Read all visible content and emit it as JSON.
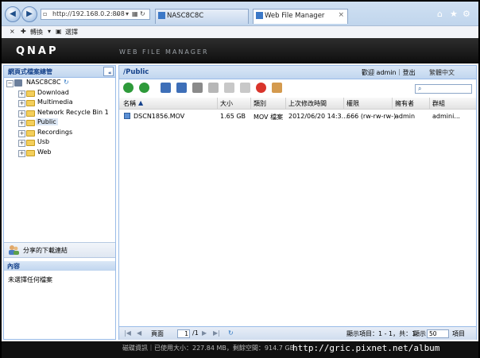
{
  "browser": {
    "address_url": "http://192.168.0.2:808",
    "tabs": [
      {
        "label": "NASC8C8C"
      },
      {
        "label": "Web File Manager"
      }
    ],
    "menubar": {
      "close": "×",
      "convert": "轉換",
      "select": "選擇"
    }
  },
  "app": {
    "logo": "QNAP",
    "title": "WEB FILE MANAGER"
  },
  "sidebar": {
    "header": "網頁式檔案總管",
    "root": "NASC8C8C",
    "folders": [
      "Download",
      "Multimedia",
      "Network Recycle Bin 1",
      "Public",
      "Recordings",
      "Usb",
      "Web"
    ],
    "selected_folder": "Public",
    "share_link": "分享的下載連結",
    "content_header": "內容",
    "content_text": "未選擇任何檔案"
  },
  "main": {
    "path": "/Public",
    "welcome": "歡迎 admin｜登出",
    "language": "繁體中文",
    "columns": [
      "名稱",
      "大小",
      "類別",
      "上次修改時間",
      "權限",
      "擁有者",
      "群組"
    ],
    "rows": [
      {
        "name": "DSCN1856.MOV",
        "size": "1.65 GB",
        "type": "MOV 檔案",
        "modified": "2012/06/20 14:3...",
        "permission": "666 (rw-rw-rw-)",
        "owner": "admin",
        "group": "admini..."
      }
    ]
  },
  "pager": {
    "page_label": "頁面",
    "page_value": "1",
    "page_total": "/1",
    "display_info": "顯示項目：1 - 1，共：1",
    "display_label": "顯示",
    "per_page": "50",
    "items_label": "項目"
  },
  "status": {
    "text": "磁碟資訊｜已使用大小：227.84 MB，剩餘空間：914.7 GB",
    "watermark": "http://gric.pixnet.net/album"
  },
  "colors": {
    "accent": "#15428b",
    "panel": "#c1d6ef",
    "banner": "#1a1a1a"
  }
}
